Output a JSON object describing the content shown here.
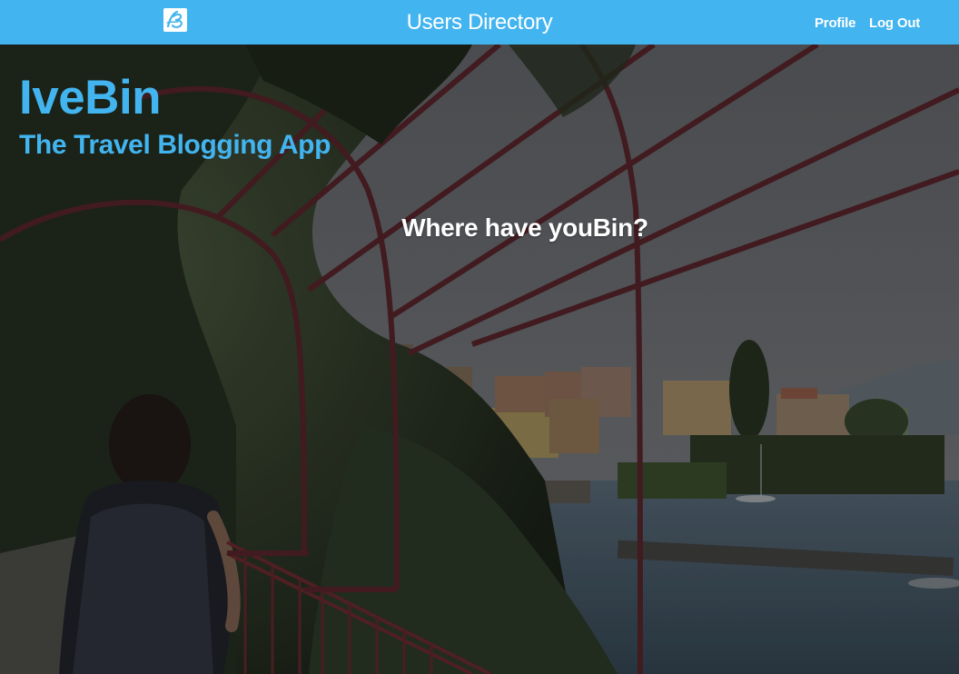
{
  "navbar": {
    "logo_icon": "ivebin-logo-icon",
    "title": "Users Directory",
    "profile_label": "Profile",
    "logout_label": "Log Out",
    "background_color": "#42b4ef"
  },
  "hero": {
    "brand_name": "IveBin",
    "tagline": "The Travel Blogging App",
    "question": "Where have youBin?",
    "brand_color": "#42b4ef",
    "background_image": "lakeside-pergola-photo"
  }
}
